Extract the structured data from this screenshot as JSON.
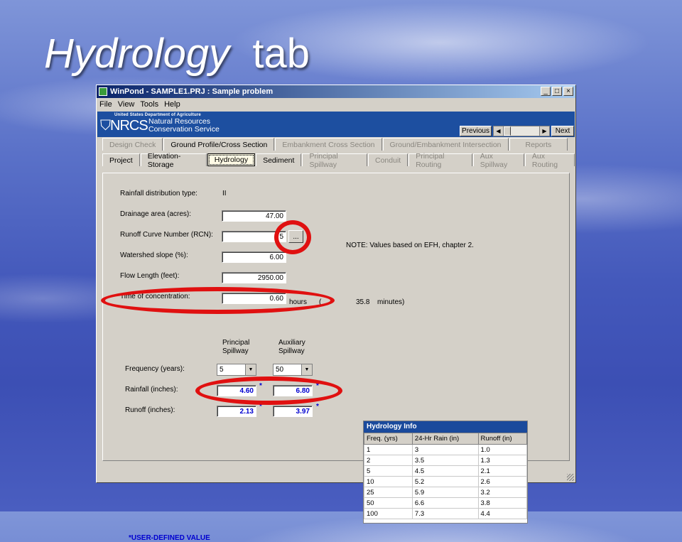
{
  "slide": {
    "title_italic": "Hydrology",
    "title_rest": "tab"
  },
  "window": {
    "title": "WinPond - SAMPLE1.PRJ : Sample problem",
    "controls": {
      "minimize": "_",
      "maximize": "□",
      "close": "×"
    },
    "menu": [
      "File",
      "View",
      "Tools",
      "Help"
    ]
  },
  "banner": {
    "agency_line": "United States Department of Agriculture",
    "logo_text": "NRCS",
    "service_line1": "Natural Resources",
    "service_line2": "Conservation Service",
    "previous_label": "Previous",
    "next_label": "Next"
  },
  "tabs_row1": [
    {
      "label": "Design Check",
      "enabled": false
    },
    {
      "label": "Ground Profile/Cross Section",
      "enabled": true
    },
    {
      "label": "Embankment Cross Section",
      "enabled": false
    },
    {
      "label": "Ground/Embankment Intersection",
      "enabled": false
    },
    {
      "label": "Reports",
      "enabled": false
    }
  ],
  "tabs_row2": [
    {
      "label": "Project",
      "enabled": true
    },
    {
      "label": "Elevation-Storage",
      "enabled": true
    },
    {
      "label": "Hydrology",
      "enabled": true,
      "active": true
    },
    {
      "label": "Sediment",
      "enabled": true
    },
    {
      "label": "Principal Spillway",
      "enabled": false
    },
    {
      "label": "Conduit",
      "enabled": false
    },
    {
      "label": "Principal Routing",
      "enabled": false
    },
    {
      "label": "Aux Spillway",
      "enabled": false
    },
    {
      "label": "Aux Routing",
      "enabled": false
    }
  ],
  "form": {
    "rainfall_dist_label": "Rainfall distribution type:",
    "rainfall_dist_value": "II",
    "drainage_label": "Drainage area (acres):",
    "drainage_value": "47.00",
    "rcn_label": "Runoff Curve Number (RCN):",
    "rcn_value": "5",
    "rcn_button": "...",
    "note": "NOTE:  Values based on EFH, chapter 2.",
    "slope_label": "Watershed slope (%):",
    "slope_value": "6.00",
    "flow_label": "Flow Length (feet):",
    "flow_value": "2950.00",
    "toc_label": "Time of concentration:",
    "toc_value": "0.60",
    "toc_unit": "hours",
    "toc_paren": "(",
    "toc_minutes_value": "35.8",
    "toc_minutes_unit": "minutes)"
  },
  "spillways": {
    "principal_header_1": "Principal",
    "principal_header_2": "Spillway",
    "aux_header_1": "Auxiliary",
    "aux_header_2": "Spillway",
    "frequency_label": "Frequency (years):",
    "principal_frequency": "5",
    "aux_frequency": "50",
    "rainfall_label": "Rainfall (inches):",
    "principal_rainfall": "4.60",
    "aux_rainfall": "6.80",
    "runoff_label": "Runoff (inches):",
    "principal_runoff": "2.13",
    "aux_runoff": "3.97",
    "star": "*",
    "user_defined_note": "*USER-DEFINED VALUE"
  },
  "hydrology_info": {
    "caption": "Hydrology Info",
    "headers": [
      "Freq. (yrs)",
      "24-Hr Rain (in)",
      "Runoff (in)"
    ],
    "rows": [
      [
        "1",
        "3",
        "1.0"
      ],
      [
        "2",
        "3.5",
        "1.3"
      ],
      [
        "5",
        "4.5",
        "2.1"
      ],
      [
        "10",
        "5.2",
        "2.6"
      ],
      [
        "25",
        "5.9",
        "3.2"
      ],
      [
        "50",
        "6.6",
        "3.8"
      ],
      [
        "100",
        "7.3",
        "4.4"
      ]
    ]
  },
  "colors": {
    "highlight_ring": "#e01010",
    "user_value": "#0000d0",
    "banner": "#1d4fa0"
  }
}
